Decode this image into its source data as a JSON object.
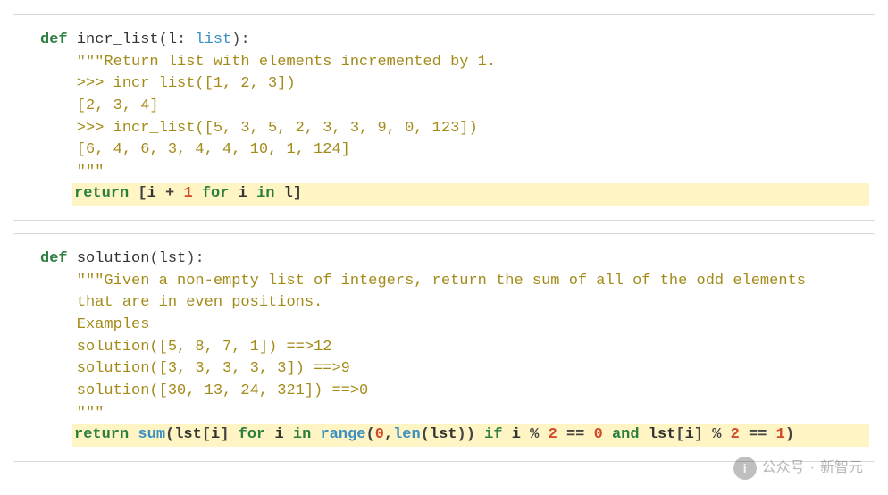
{
  "blocks": [
    {
      "id": "incr_list",
      "signature": {
        "def": "def",
        "space1": " ",
        "name": "incr_list",
        "open": "(",
        "param": "l",
        "colon_type": ": ",
        "type": "list",
        "close_sig": "):"
      },
      "docstring": [
        "    \"\"\"Return list with elements incremented by 1.",
        "    >>> incr_list([1, 2, 3])",
        "    [2, 3, 4]",
        "    >>> incr_list([5, 3, 5, 2, 3, 3, 9, 0, 123])",
        "    [6, 4, 6, 3, 4, 4, 10, 1, 124]",
        "    \"\"\""
      ],
      "highlight": {
        "return": "return",
        "space_a": " ",
        "lbr": "[",
        "i1": "i",
        "plus": " + ",
        "one": "1",
        "space_b": " ",
        "for": "for",
        "space_c": " ",
        "i2": "i",
        "space_d": " ",
        "in": "in",
        "space_e": " ",
        "seq": "l",
        "rbr": "]"
      }
    },
    {
      "id": "solution",
      "signature": {
        "def": "def",
        "space1": " ",
        "name": "solution",
        "open": "(",
        "param": "lst",
        "close_sig": "):"
      },
      "docstring": [
        "    \"\"\"Given a non-empty list of integers, return the sum of all of the odd elements",
        "    that are in even positions.",
        "",
        "    Examples",
        "    solution([5, 8, 7, 1]) ==>12",
        "    solution([3, 3, 3, 3, 3]) ==>9",
        "    solution([30, 13, 24, 321]) ==>0",
        "    \"\"\""
      ],
      "highlight": {
        "return": "return",
        "space_a": " ",
        "sum": "sum",
        "open1": "(",
        "lst1": "lst",
        "lbr1": "[",
        "i1": "i",
        "rbr1": "]",
        "space_b": " ",
        "for": "for",
        "space_c": " ",
        "i2": "i",
        "space_d": " ",
        "in": "in",
        "space_e": " ",
        "range": "range",
        "open2": "(",
        "zero": "0",
        "comma": ",",
        "len": "len",
        "open3": "(",
        "lst2": "lst",
        "close3": ")",
        "close2": ")",
        "space_f": " ",
        "if": "if",
        "space_g": " ",
        "i3": "i",
        "mod1": " % ",
        "two1": "2",
        "eq1": " == ",
        "zero2": "0",
        "space_h": " ",
        "and": "and",
        "space_i": " ",
        "lst3": "lst",
        "lbr2": "[",
        "i4": "i",
        "rbr2": "]",
        "mod2": " % ",
        "two2": "2",
        "eq2": " == ",
        "one": "1",
        "close1": ")"
      }
    }
  ],
  "watermark": {
    "icon_label": "i",
    "text_prefix": "公众号",
    "separator": "·",
    "text_name": "新智元"
  }
}
